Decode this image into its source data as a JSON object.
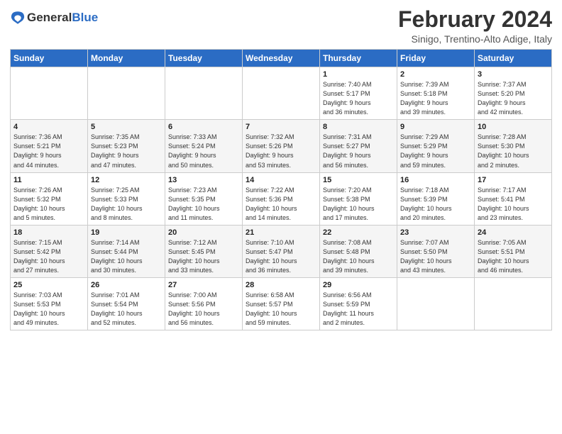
{
  "logo": {
    "line1": "General",
    "line2": "Blue"
  },
  "title": "February 2024",
  "location": "Sinigo, Trentino-Alto Adige, Italy",
  "weekdays": [
    "Sunday",
    "Monday",
    "Tuesday",
    "Wednesday",
    "Thursday",
    "Friday",
    "Saturday"
  ],
  "weeks": [
    [
      {
        "day": "",
        "info": ""
      },
      {
        "day": "",
        "info": ""
      },
      {
        "day": "",
        "info": ""
      },
      {
        "day": "",
        "info": ""
      },
      {
        "day": "1",
        "info": "Sunrise: 7:40 AM\nSunset: 5:17 PM\nDaylight: 9 hours\nand 36 minutes."
      },
      {
        "day": "2",
        "info": "Sunrise: 7:39 AM\nSunset: 5:18 PM\nDaylight: 9 hours\nand 39 minutes."
      },
      {
        "day": "3",
        "info": "Sunrise: 7:37 AM\nSunset: 5:20 PM\nDaylight: 9 hours\nand 42 minutes."
      }
    ],
    [
      {
        "day": "4",
        "info": "Sunrise: 7:36 AM\nSunset: 5:21 PM\nDaylight: 9 hours\nand 44 minutes."
      },
      {
        "day": "5",
        "info": "Sunrise: 7:35 AM\nSunset: 5:23 PM\nDaylight: 9 hours\nand 47 minutes."
      },
      {
        "day": "6",
        "info": "Sunrise: 7:33 AM\nSunset: 5:24 PM\nDaylight: 9 hours\nand 50 minutes."
      },
      {
        "day": "7",
        "info": "Sunrise: 7:32 AM\nSunset: 5:26 PM\nDaylight: 9 hours\nand 53 minutes."
      },
      {
        "day": "8",
        "info": "Sunrise: 7:31 AM\nSunset: 5:27 PM\nDaylight: 9 hours\nand 56 minutes."
      },
      {
        "day": "9",
        "info": "Sunrise: 7:29 AM\nSunset: 5:29 PM\nDaylight: 9 hours\nand 59 minutes."
      },
      {
        "day": "10",
        "info": "Sunrise: 7:28 AM\nSunset: 5:30 PM\nDaylight: 10 hours\nand 2 minutes."
      }
    ],
    [
      {
        "day": "11",
        "info": "Sunrise: 7:26 AM\nSunset: 5:32 PM\nDaylight: 10 hours\nand 5 minutes."
      },
      {
        "day": "12",
        "info": "Sunrise: 7:25 AM\nSunset: 5:33 PM\nDaylight: 10 hours\nand 8 minutes."
      },
      {
        "day": "13",
        "info": "Sunrise: 7:23 AM\nSunset: 5:35 PM\nDaylight: 10 hours\nand 11 minutes."
      },
      {
        "day": "14",
        "info": "Sunrise: 7:22 AM\nSunset: 5:36 PM\nDaylight: 10 hours\nand 14 minutes."
      },
      {
        "day": "15",
        "info": "Sunrise: 7:20 AM\nSunset: 5:38 PM\nDaylight: 10 hours\nand 17 minutes."
      },
      {
        "day": "16",
        "info": "Sunrise: 7:18 AM\nSunset: 5:39 PM\nDaylight: 10 hours\nand 20 minutes."
      },
      {
        "day": "17",
        "info": "Sunrise: 7:17 AM\nSunset: 5:41 PM\nDaylight: 10 hours\nand 23 minutes."
      }
    ],
    [
      {
        "day": "18",
        "info": "Sunrise: 7:15 AM\nSunset: 5:42 PM\nDaylight: 10 hours\nand 27 minutes."
      },
      {
        "day": "19",
        "info": "Sunrise: 7:14 AM\nSunset: 5:44 PM\nDaylight: 10 hours\nand 30 minutes."
      },
      {
        "day": "20",
        "info": "Sunrise: 7:12 AM\nSunset: 5:45 PM\nDaylight: 10 hours\nand 33 minutes."
      },
      {
        "day": "21",
        "info": "Sunrise: 7:10 AM\nSunset: 5:47 PM\nDaylight: 10 hours\nand 36 minutes."
      },
      {
        "day": "22",
        "info": "Sunrise: 7:08 AM\nSunset: 5:48 PM\nDaylight: 10 hours\nand 39 minutes."
      },
      {
        "day": "23",
        "info": "Sunrise: 7:07 AM\nSunset: 5:50 PM\nDaylight: 10 hours\nand 43 minutes."
      },
      {
        "day": "24",
        "info": "Sunrise: 7:05 AM\nSunset: 5:51 PM\nDaylight: 10 hours\nand 46 minutes."
      }
    ],
    [
      {
        "day": "25",
        "info": "Sunrise: 7:03 AM\nSunset: 5:53 PM\nDaylight: 10 hours\nand 49 minutes."
      },
      {
        "day": "26",
        "info": "Sunrise: 7:01 AM\nSunset: 5:54 PM\nDaylight: 10 hours\nand 52 minutes."
      },
      {
        "day": "27",
        "info": "Sunrise: 7:00 AM\nSunset: 5:56 PM\nDaylight: 10 hours\nand 56 minutes."
      },
      {
        "day": "28",
        "info": "Sunrise: 6:58 AM\nSunset: 5:57 PM\nDaylight: 10 hours\nand 59 minutes."
      },
      {
        "day": "29",
        "info": "Sunrise: 6:56 AM\nSunset: 5:59 PM\nDaylight: 11 hours\nand 2 minutes."
      },
      {
        "day": "",
        "info": ""
      },
      {
        "day": "",
        "info": ""
      }
    ]
  ]
}
